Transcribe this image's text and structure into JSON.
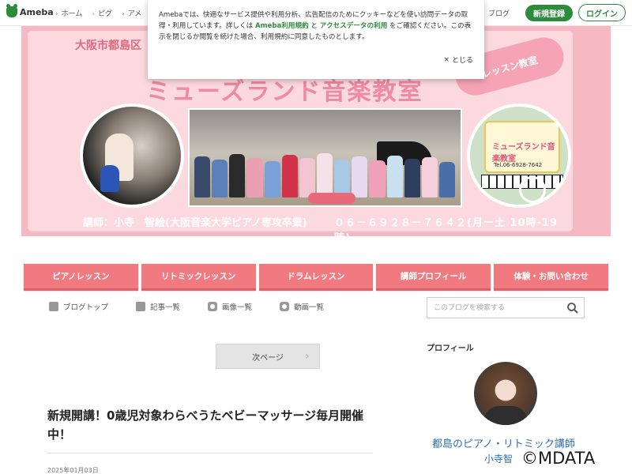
{
  "topbar": {
    "logo": "Ameba",
    "nav": [
      "ホーム",
      "ピグ",
      "アメ"
    ],
    "right_link": "ブログ",
    "register": "新規登録",
    "login": "ログイン"
  },
  "cookie": {
    "text_before": "Amebaでは、快適なサービス提供や利用分析、広告配信のためにクッキーなどを使い訪問データの取得・利用しています。詳しくは",
    "link1": "Ameba利用規約",
    "conj": "と",
    "link2": "アクセスデータの利用",
    "text_after": "をご確認ください。この表示を閉じるか閲覧を続けた場合、利用規約に同意したものとします。",
    "close": "とじる"
  },
  "banner": {
    "heading": "大阪市都島区",
    "title": "ミューズランド音楽教室",
    "tag": "レッスン教室",
    "sign_title": "ミューズランド音楽教室",
    "sign_tel": "Tel.06-6928-7642",
    "teacher": "講師：小寺　智絵(大阪音楽大学ピアノ専攻卒業)",
    "tel": "０６－６９２８－７６４２(月ー土 10時-19時)"
  },
  "tabs": [
    "ピアノレッスン",
    "リトミックレッスン",
    "ドラムレッスン",
    "講師プロフィール",
    "体験・お問い合わせ"
  ],
  "subnav": [
    "ブログトップ",
    "記事一覧",
    "画像一覧",
    "動画一覧"
  ],
  "search": {
    "placeholder": "このブログを検索する"
  },
  "pager": {
    "next": "次ページ"
  },
  "article": {
    "title": "新規開講！0歳児対象わらべうたベビーマッサージ毎月開催中！",
    "date": "2025年01月03日"
  },
  "profile": {
    "label": "プロフィール",
    "name": "都島のピアノ・リトミック講師",
    "sub": "小寺智"
  },
  "watermark": "©MDATA",
  "colors": {
    "brand_green": "#2d8c3c",
    "tab_pink": "#f07a80",
    "link_blue": "#2b70b8"
  }
}
